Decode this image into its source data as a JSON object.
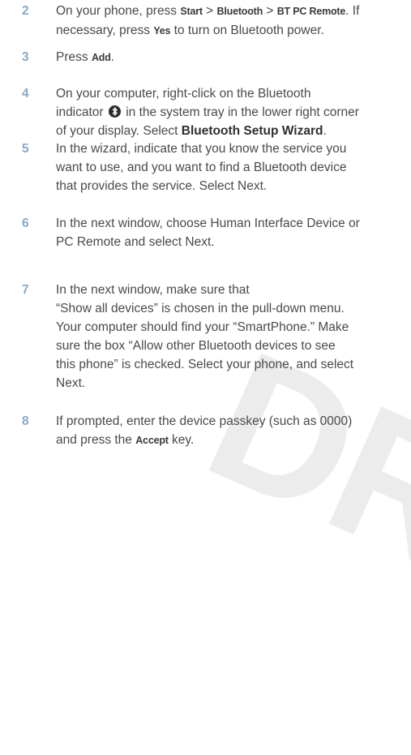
{
  "watermark": "DRAFT",
  "steps": [
    {
      "num": "2",
      "lines": [
        {
          "parts": [
            {
              "t": "On your phone, press "
            },
            {
              "t": "Start",
              "k": 1
            },
            {
              "t": " > "
            },
            {
              "t": "Bluetooth",
              "k": 1
            },
            {
              "t": " > "
            },
            {
              "t": "BT PC Remote",
              "k": 1
            },
            {
              "t": ". If"
            }
          ]
        },
        {
          "parts": [
            {
              "t": "necessary, press "
            },
            {
              "t": "Yes",
              "k": 1
            },
            {
              "t": " to turn on Bluetooth power."
            }
          ]
        }
      ]
    },
    {
      "num": "3",
      "lines": [
        {
          "parts": [
            {
              "t": "Press "
            },
            {
              "t": "Add",
              "k": 1
            },
            {
              "t": "."
            }
          ]
        }
      ]
    },
    {
      "num": "4",
      "lines": [
        {
          "parts": [
            {
              "t": "On your computer, right-click on the Bluetooth"
            }
          ]
        },
        {
          "parts": [
            {
              "t": "indicator "
            },
            {
              "icon": "bluetooth-icon"
            },
            {
              "t": " in the system tray in the lower right corner"
            }
          ]
        },
        {
          "parts": [
            {
              "t": "of your display. Select "
            },
            {
              "t": "Bluetooth Setup Wizard",
              "b": 1
            },
            {
              "t": "."
            }
          ]
        }
      ]
    },
    {
      "num": "5",
      "lines": [
        {
          "parts": [
            {
              "t": "In the wizard, indicate that you know the service you"
            }
          ]
        },
        {
          "parts": [
            {
              "t": "want to use, and you want to find a Bluetooth device"
            }
          ]
        },
        {
          "parts": [
            {
              "t": "that provides the service. Select Next."
            }
          ]
        }
      ]
    },
    {
      "num": "6",
      "lines": [
        {
          "parts": [
            {
              "t": "In the next window, choose Human Interface Device or"
            }
          ]
        },
        {
          "parts": [
            {
              "t": "PC Remote and select Next."
            }
          ]
        }
      ]
    },
    {
      "num": "7",
      "lines": [
        {
          "parts": [
            {
              "t": "In the next window, make sure that"
            }
          ]
        },
        {
          "parts": [
            {
              "t": "“Show all devices” is chosen in the pull-down menu."
            }
          ]
        },
        {
          "parts": [
            {
              "t": "Your computer should find your “SmartPhone.” Make"
            }
          ]
        },
        {
          "parts": [
            {
              "t": "sure the box “Allow other Bluetooth devices to see"
            }
          ]
        },
        {
          "parts": [
            {
              "t": "this phone” is checked. Select your phone, and select"
            }
          ]
        },
        {
          "parts": [
            {
              "t": "Next."
            }
          ]
        }
      ]
    },
    {
      "num": "8",
      "lines": [
        {
          "parts": [
            {
              "t": "If prompted, enter the device passkey (such as 0000)"
            }
          ]
        },
        {
          "parts": [
            {
              "t": "and press the "
            },
            {
              "t": "Accept",
              "k": 1
            },
            {
              "t": " key."
            }
          ]
        }
      ]
    }
  ]
}
